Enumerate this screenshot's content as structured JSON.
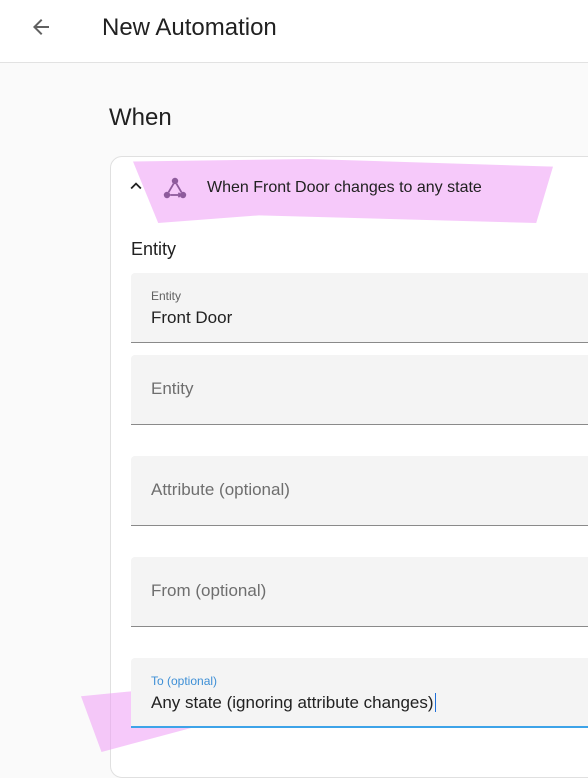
{
  "topbar": {
    "title": "New Automation",
    "back_icon": "arrow-left-icon"
  },
  "section": {
    "title": "When"
  },
  "trigger": {
    "header_text": "When Front Door changes to any state",
    "chevron_icon": "chevron-up-icon",
    "type_icon": "state-trigger-icon",
    "icon_color": "#8e5b9c",
    "entity_label": "Entity",
    "fields": {
      "entity_selected": {
        "floating_label": "Entity",
        "value": "Front Door"
      },
      "entity_add": {
        "label": "Entity"
      },
      "attribute": {
        "label": "Attribute (optional)"
      },
      "from": {
        "label": "From (optional)"
      },
      "to": {
        "floating_label": "To (optional)",
        "value": "Any state (ignoring attribute changes)"
      }
    }
  },
  "colors": {
    "highlight": "#ee9cf5",
    "focus_accent": "#3da3e8"
  }
}
